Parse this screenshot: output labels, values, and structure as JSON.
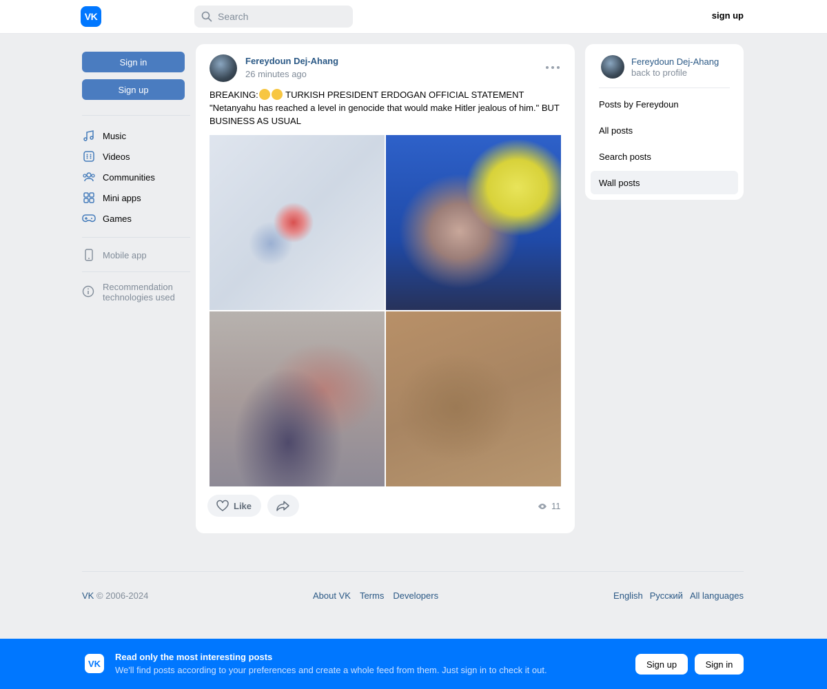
{
  "header": {
    "logo": "VK",
    "search_placeholder": "Search",
    "signup_label": "sign up"
  },
  "left_nav": {
    "signin_label": "Sign in",
    "signup_label": "Sign up",
    "items": [
      {
        "label": "Music",
        "icon": "music-note-icon"
      },
      {
        "label": "Videos",
        "icon": "video-icon"
      },
      {
        "label": "Communities",
        "icon": "communities-icon"
      },
      {
        "label": "Mini apps",
        "icon": "mini-apps-icon"
      },
      {
        "label": "Games",
        "icon": "gamepad-icon"
      }
    ],
    "mobile_app_label": "Mobile app",
    "recommendation_line1": "Recommendation",
    "recommendation_line2": "technologies used"
  },
  "post": {
    "author": "Fereydoun Dej-Ahang",
    "time": "26 minutes ago",
    "text_before_emoji": "BREAKING:",
    "text_after_emoji": " TURKISH PRESIDENT ERDOGAN OFFICIAL STATEMENT \"Netanyahu has reached a level in genocide that would make Hitler jealous of him.\" BUT BUSINESS AS USUAL",
    "like_label": "Like",
    "views": "11"
  },
  "right_panel": {
    "name": "Fereydoun Dej-Ahang",
    "back_label": "back to profile",
    "items": [
      {
        "label": "Posts by Fereydoun",
        "active": false
      },
      {
        "label": "All posts",
        "active": false
      },
      {
        "label": "Search posts",
        "active": false
      },
      {
        "label": "Wall posts",
        "active": true
      }
    ]
  },
  "footer": {
    "brand": "VK",
    "copyright": "© 2006-2024",
    "links": [
      "About VK",
      "Terms",
      "Developers"
    ],
    "languages": [
      "English",
      "Русский",
      "All languages"
    ]
  },
  "banner": {
    "logo": "VK",
    "title": "Read only the most interesting posts",
    "subtitle": "We'll find posts according to your preferences and create a whole feed from them. Just sign in to check it out.",
    "signup_label": "Sign up",
    "signin_label": "Sign in"
  },
  "colors": {
    "accent": "#0077ff",
    "button_blue": "#4a7cc0",
    "link": "#2a5885",
    "background": "#edeef0"
  }
}
